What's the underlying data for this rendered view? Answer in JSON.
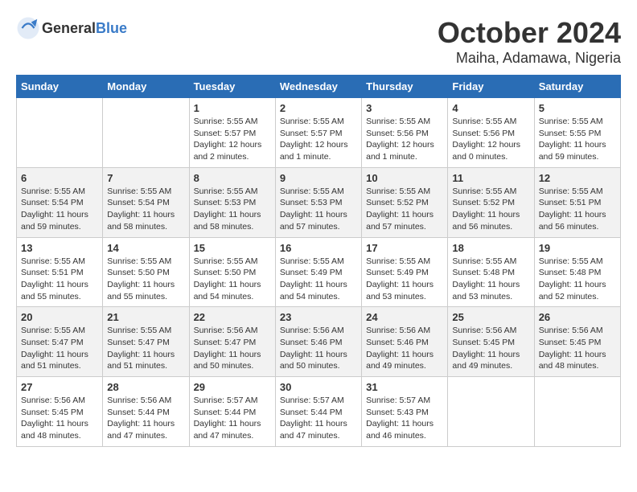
{
  "header": {
    "logo_general": "General",
    "logo_blue": "Blue",
    "month": "October 2024",
    "location": "Maiha, Adamawa, Nigeria"
  },
  "columns": [
    "Sunday",
    "Monday",
    "Tuesday",
    "Wednesday",
    "Thursday",
    "Friday",
    "Saturday"
  ],
  "weeks": [
    [
      {
        "day": "",
        "detail": ""
      },
      {
        "day": "",
        "detail": ""
      },
      {
        "day": "1",
        "detail": "Sunrise: 5:55 AM\nSunset: 5:57 PM\nDaylight: 12 hours\nand 2 minutes."
      },
      {
        "day": "2",
        "detail": "Sunrise: 5:55 AM\nSunset: 5:57 PM\nDaylight: 12 hours\nand 1 minute."
      },
      {
        "day": "3",
        "detail": "Sunrise: 5:55 AM\nSunset: 5:56 PM\nDaylight: 12 hours\nand 1 minute."
      },
      {
        "day": "4",
        "detail": "Sunrise: 5:55 AM\nSunset: 5:56 PM\nDaylight: 12 hours\nand 0 minutes."
      },
      {
        "day": "5",
        "detail": "Sunrise: 5:55 AM\nSunset: 5:55 PM\nDaylight: 11 hours\nand 59 minutes."
      }
    ],
    [
      {
        "day": "6",
        "detail": "Sunrise: 5:55 AM\nSunset: 5:54 PM\nDaylight: 11 hours\nand 59 minutes."
      },
      {
        "day": "7",
        "detail": "Sunrise: 5:55 AM\nSunset: 5:54 PM\nDaylight: 11 hours\nand 58 minutes."
      },
      {
        "day": "8",
        "detail": "Sunrise: 5:55 AM\nSunset: 5:53 PM\nDaylight: 11 hours\nand 58 minutes."
      },
      {
        "day": "9",
        "detail": "Sunrise: 5:55 AM\nSunset: 5:53 PM\nDaylight: 11 hours\nand 57 minutes."
      },
      {
        "day": "10",
        "detail": "Sunrise: 5:55 AM\nSunset: 5:52 PM\nDaylight: 11 hours\nand 57 minutes."
      },
      {
        "day": "11",
        "detail": "Sunrise: 5:55 AM\nSunset: 5:52 PM\nDaylight: 11 hours\nand 56 minutes."
      },
      {
        "day": "12",
        "detail": "Sunrise: 5:55 AM\nSunset: 5:51 PM\nDaylight: 11 hours\nand 56 minutes."
      }
    ],
    [
      {
        "day": "13",
        "detail": "Sunrise: 5:55 AM\nSunset: 5:51 PM\nDaylight: 11 hours\nand 55 minutes."
      },
      {
        "day": "14",
        "detail": "Sunrise: 5:55 AM\nSunset: 5:50 PM\nDaylight: 11 hours\nand 55 minutes."
      },
      {
        "day": "15",
        "detail": "Sunrise: 5:55 AM\nSunset: 5:50 PM\nDaylight: 11 hours\nand 54 minutes."
      },
      {
        "day": "16",
        "detail": "Sunrise: 5:55 AM\nSunset: 5:49 PM\nDaylight: 11 hours\nand 54 minutes."
      },
      {
        "day": "17",
        "detail": "Sunrise: 5:55 AM\nSunset: 5:49 PM\nDaylight: 11 hours\nand 53 minutes."
      },
      {
        "day": "18",
        "detail": "Sunrise: 5:55 AM\nSunset: 5:48 PM\nDaylight: 11 hours\nand 53 minutes."
      },
      {
        "day": "19",
        "detail": "Sunrise: 5:55 AM\nSunset: 5:48 PM\nDaylight: 11 hours\nand 52 minutes."
      }
    ],
    [
      {
        "day": "20",
        "detail": "Sunrise: 5:55 AM\nSunset: 5:47 PM\nDaylight: 11 hours\nand 51 minutes."
      },
      {
        "day": "21",
        "detail": "Sunrise: 5:55 AM\nSunset: 5:47 PM\nDaylight: 11 hours\nand 51 minutes."
      },
      {
        "day": "22",
        "detail": "Sunrise: 5:56 AM\nSunset: 5:47 PM\nDaylight: 11 hours\nand 50 minutes."
      },
      {
        "day": "23",
        "detail": "Sunrise: 5:56 AM\nSunset: 5:46 PM\nDaylight: 11 hours\nand 50 minutes."
      },
      {
        "day": "24",
        "detail": "Sunrise: 5:56 AM\nSunset: 5:46 PM\nDaylight: 11 hours\nand 49 minutes."
      },
      {
        "day": "25",
        "detail": "Sunrise: 5:56 AM\nSunset: 5:45 PM\nDaylight: 11 hours\nand 49 minutes."
      },
      {
        "day": "26",
        "detail": "Sunrise: 5:56 AM\nSunset: 5:45 PM\nDaylight: 11 hours\nand 48 minutes."
      }
    ],
    [
      {
        "day": "27",
        "detail": "Sunrise: 5:56 AM\nSunset: 5:45 PM\nDaylight: 11 hours\nand 48 minutes."
      },
      {
        "day": "28",
        "detail": "Sunrise: 5:56 AM\nSunset: 5:44 PM\nDaylight: 11 hours\nand 47 minutes."
      },
      {
        "day": "29",
        "detail": "Sunrise: 5:57 AM\nSunset: 5:44 PM\nDaylight: 11 hours\nand 47 minutes."
      },
      {
        "day": "30",
        "detail": "Sunrise: 5:57 AM\nSunset: 5:44 PM\nDaylight: 11 hours\nand 47 minutes."
      },
      {
        "day": "31",
        "detail": "Sunrise: 5:57 AM\nSunset: 5:43 PM\nDaylight: 11 hours\nand 46 minutes."
      },
      {
        "day": "",
        "detail": ""
      },
      {
        "day": "",
        "detail": ""
      }
    ]
  ]
}
